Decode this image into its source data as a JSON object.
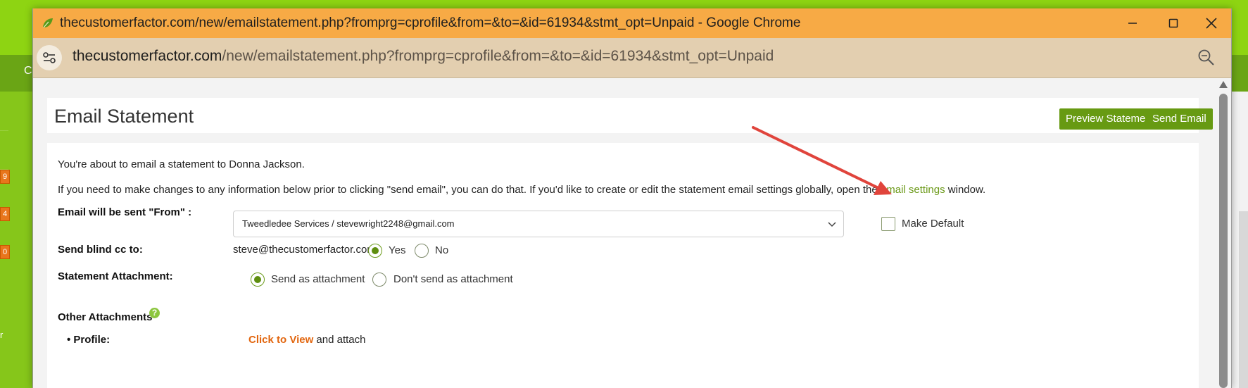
{
  "background": {
    "nav_fragment": "C",
    "left_badges": [
      "9",
      "4",
      "0"
    ],
    "left_fragment": "r"
  },
  "window": {
    "title": "thecustomerfactor.com/new/emailstatement.php?fromprg=cprofile&from=&to=&id=61934&stmt_opt=Unpaid - Google Chrome",
    "url_host": "thecustomerfactor.com",
    "url_path": "/new/emailstatement.php?fromprg=cprofile&from=&to=&id=61934&stmt_opt=Unpaid",
    "icons": {
      "favicon": "leaf-icon",
      "minimize": "minimize-icon",
      "maximize": "maximize-icon",
      "close": "close-icon",
      "site_info": "site-info-icon",
      "zoom": "zoom-icon"
    },
    "colors": {
      "titlebar": "#f7aa45",
      "addressbar": "#e3cfb0"
    }
  },
  "page": {
    "title": "Email Statement",
    "preview_button": "Preview Statement",
    "send_button": "Send Email",
    "intro": "You're about to email a statement to Donna Jackson.",
    "instructions_before": "If you need to make changes to any information below prior to clicking \"send email\", you can do that. If you'd like to create or edit the statement email settings globally, open the ",
    "instructions_link": "email settings",
    "instructions_after": " window.",
    "from_label": "Email will be sent \"From\" :",
    "from_value": "Tweedledee Services / stevewright2248@gmail.com",
    "make_default_label": "Make Default",
    "bcc_label": "Send blind cc to:",
    "bcc_email": "steve@thecustomerfactor.com",
    "bcc_yes": "Yes",
    "bcc_no": "No",
    "bcc_selected": "Yes",
    "attach_label": "Statement Attachment:",
    "attach_send": "Send as attachment",
    "attach_dont": "Don't send as attachment",
    "attach_selected": "Send as attachment",
    "other_label": "Other Attachments",
    "help_glyph": "?",
    "profile_label": "• Profile:",
    "profile_link": "Click to View",
    "profile_after": " and attach",
    "colors": {
      "accent": "#679a12",
      "link_green": "#6c9a1a",
      "link_orange": "#e2660f",
      "annotation_arrow": "#e0443c"
    }
  }
}
